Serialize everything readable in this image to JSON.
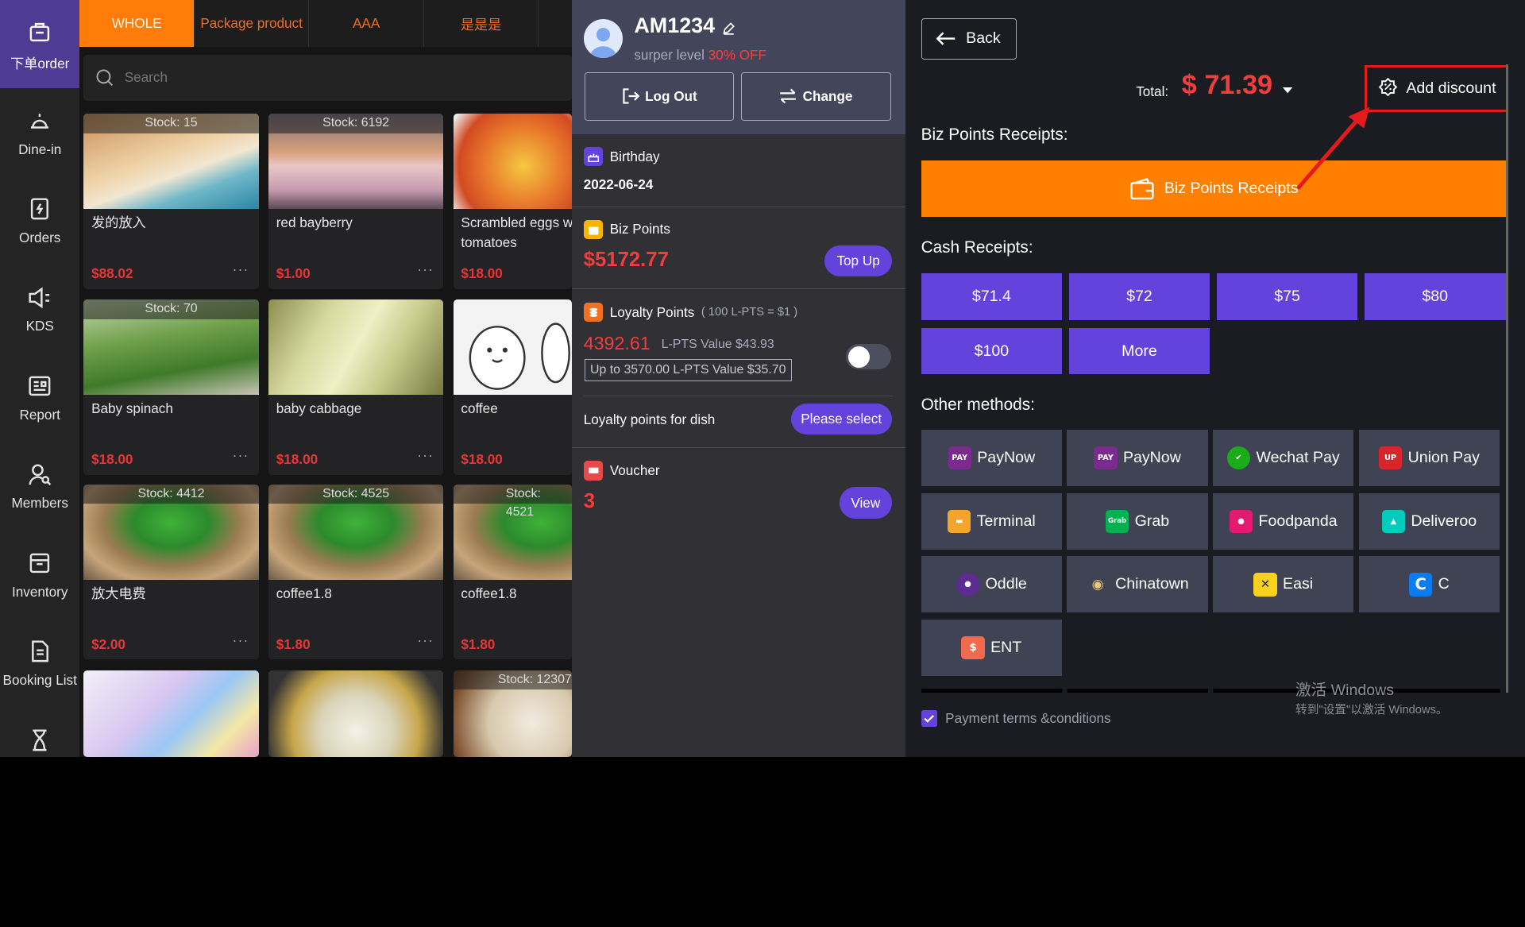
{
  "nav": {
    "items": [
      {
        "label": "下单order",
        "icon": "cashier-icon",
        "active": true
      },
      {
        "label": "Dine-in",
        "icon": "bell-icon"
      },
      {
        "label": "Orders",
        "icon": "orders-icon"
      },
      {
        "label": "KDS",
        "icon": "speaker-icon"
      },
      {
        "label": "Report",
        "icon": "report-icon"
      },
      {
        "label": "Members",
        "icon": "members-icon"
      },
      {
        "label": "Inventory",
        "icon": "inventory-icon"
      },
      {
        "label": "Booking List",
        "icon": "booking-icon"
      }
    ]
  },
  "menu": {
    "categories": [
      "WHOLE",
      "Package product",
      "AAA",
      "是是是"
    ],
    "search_placeholder": "Search",
    "products": [
      {
        "stock": "Stock:  15",
        "name": "发的放入",
        "price": "$88.02"
      },
      {
        "stock": "Stock:  6192",
        "name": "red bayberry",
        "price": "$1.00"
      },
      {
        "stock": "",
        "name": "Scrambled eggs with tomatoes",
        "price": "$18.00"
      },
      {
        "stock": "Stock:  70",
        "name": "Baby spinach",
        "price": "$18.00"
      },
      {
        "stock": "",
        "name": "baby cabbage",
        "price": "$18.00"
      },
      {
        "stock": "",
        "name": "coffee",
        "price": "$18.00"
      },
      {
        "stock": "Stock:  4412",
        "name": "放大电费",
        "price": "$2.00"
      },
      {
        "stock": "Stock:  4525",
        "name": "coffee1.8",
        "price": "$1.80"
      },
      {
        "stock": "Stock:  4521",
        "name": "coffee1.8",
        "price": "$1.80"
      },
      {
        "stock": "",
        "name": "",
        "price": ""
      },
      {
        "stock": "",
        "name": "",
        "price": ""
      },
      {
        "stock": "Stock:  12307",
        "name": "",
        "price": ""
      }
    ],
    "more_glyph": "···"
  },
  "member": {
    "id": "AM1234",
    "level_text": "surper level",
    "level_discount": "30% OFF",
    "logout_label": "Log Out",
    "change_label": "Change",
    "birthday_label": "Birthday",
    "birthday_value": "2022-06-24",
    "biz_points_label": "Biz Points",
    "biz_points_value": "$5172.77",
    "topup_label": "Top Up",
    "loyalty_label": "Loyalty Points",
    "loyalty_rate": "( 100 L-PTS = $1 )",
    "loyalty_value": "4392.61",
    "loyalty_pts_value": "L-PTS Value $43.93",
    "loyalty_limit": "Up to 3570.00 L-PTS Value $35.70",
    "loyalty_toggle_on": false,
    "loyalty_dish_label": "Loyalty points for dish",
    "please_select_label": "Please select",
    "voucher_label": "Voucher",
    "voucher_count": "3",
    "view_label": "View"
  },
  "pay": {
    "back_label": "Back",
    "total_label": "Total:",
    "total_value": "$ 71.39",
    "add_discount_label": "Add discount",
    "biz_section_label": "Biz Points Receipts:",
    "biz_button_label": "Biz Points Receipts",
    "cash_section_label": "Cash Receipts:",
    "cash_options": [
      "$71.4",
      "$72",
      "$75",
      "$80",
      "$100",
      "More"
    ],
    "other_section_label": "Other methods:",
    "methods": [
      {
        "label": "PayNow",
        "icon": "paynow-icon",
        "color": "#7b2a8f",
        "glyph": "PAY NOW"
      },
      {
        "label": "PayNow",
        "icon": "paynow-icon",
        "color": "#7b2a8f",
        "glyph": "PAY NOW"
      },
      {
        "label": "Wechat Pay",
        "icon": "wechat-pay-icon",
        "color": "#1aad19",
        "glyph": "✔"
      },
      {
        "label": "Union Pay",
        "icon": "union-pay-icon",
        "color": "#d7262b",
        "glyph": "UP"
      },
      {
        "label": "Terminal",
        "icon": "terminal-icon",
        "color": "#f3a52c",
        "glyph": "▬"
      },
      {
        "label": "Grab",
        "icon": "grab-icon",
        "color": "#00b14f",
        "glyph": "Grab"
      },
      {
        "label": "Foodpanda",
        "icon": "foodpanda-icon",
        "color": "#e21b70",
        "glyph": "●"
      },
      {
        "label": "Deliveroo",
        "icon": "deliveroo-icon",
        "color": "#00ccbc",
        "glyph": "▲"
      },
      {
        "label": "Oddle",
        "icon": "oddle-icon",
        "color": "#5b2d91",
        "glyph": "●"
      },
      {
        "label": "Chinatown",
        "icon": "chinatown-icon",
        "color": "#3f4353",
        "glyph": "◉"
      },
      {
        "label": "Easi",
        "icon": "easi-icon",
        "color": "#f8d21c",
        "glyph": "✕"
      },
      {
        "label": "C",
        "icon": "c-icon",
        "color": "#0a7cf0",
        "glyph": "C"
      },
      {
        "label": "ENT",
        "icon": "ent-icon",
        "color": "#f06a4e",
        "glyph": "$"
      }
    ],
    "terms_label": "Payment terms &conditions",
    "windows_line1": "激活 Windows",
    "windows_line2": "转到\"设置\"以激活 Windows。"
  }
}
